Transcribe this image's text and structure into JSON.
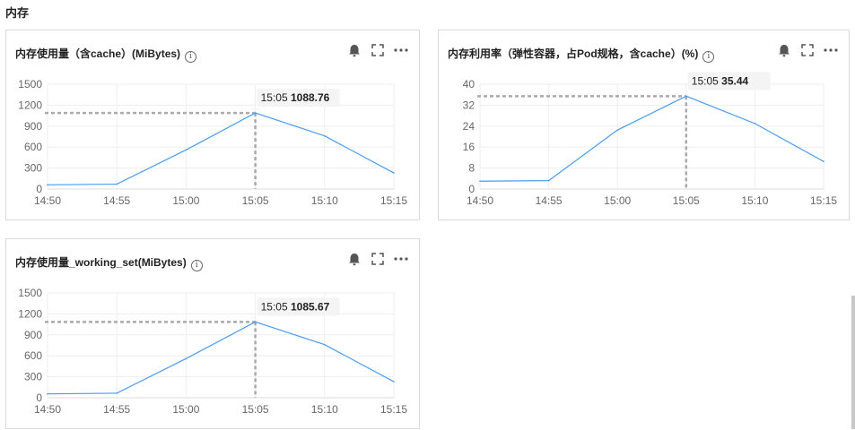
{
  "section": {
    "title": "内存"
  },
  "colors": {
    "line": "#4a9bf0",
    "grid": "#eeeeee",
    "crosshair": "#aaaaaa",
    "axis_text": "#666666"
  },
  "panels": [
    {
      "title": "内存使用量（含cache）(MiBytes)",
      "info_glyph": "i",
      "tooltip": {
        "time": "15:05",
        "value": "1088.76"
      },
      "chart_data": {
        "type": "line",
        "x": [
          "14:50",
          "14:55",
          "15:00",
          "15:05",
          "15:10",
          "15:15"
        ],
        "series": [
          {
            "values": [
              60,
              70,
              560,
              1088.76,
              760,
              230
            ]
          }
        ],
        "yticks": [
          0,
          300,
          600,
          900,
          1200,
          1500
        ],
        "ylim": [
          0,
          1500
        ],
        "highlight_index": 3,
        "grid": true
      }
    },
    {
      "title": "内存利用率（弹性容器，占Pod规格，含cache）(%)",
      "info_glyph": "i",
      "tooltip": {
        "time": "15:05",
        "value": "35.44"
      },
      "chart_data": {
        "type": "line",
        "x": [
          "14:50",
          "14:55",
          "15:00",
          "15:05",
          "15:10",
          "15:15"
        ],
        "series": [
          {
            "values": [
              3,
              3.2,
              22.5,
              35.44,
              25,
              10.5
            ]
          }
        ],
        "yticks": [
          0,
          8,
          16,
          24,
          32,
          40
        ],
        "ylim": [
          0,
          40
        ],
        "highlight_index": 3,
        "grid": true
      }
    },
    {
      "title": "内存使用量_working_set(MiBytes)",
      "info_glyph": "i",
      "tooltip": {
        "time": "15:05",
        "value": "1085.67"
      },
      "chart_data": {
        "type": "line",
        "x": [
          "14:50",
          "14:55",
          "15:00",
          "15:05",
          "15:10",
          "15:15"
        ],
        "series": [
          {
            "values": [
              55,
              65,
              560,
              1085.67,
              760,
              230
            ]
          }
        ],
        "yticks": [
          0,
          300,
          600,
          900,
          1200,
          1500
        ],
        "ylim": [
          0,
          1500
        ],
        "highlight_index": 3,
        "grid": true
      }
    }
  ]
}
